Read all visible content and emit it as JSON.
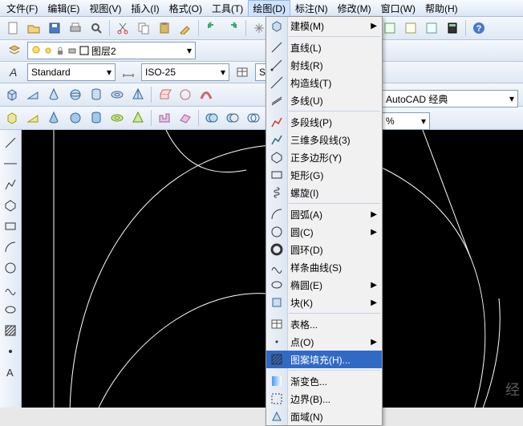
{
  "menubar": {
    "items": [
      {
        "label": "文件(F)"
      },
      {
        "label": "编辑(E)"
      },
      {
        "label": "视图(V)"
      },
      {
        "label": "插入(I)"
      },
      {
        "label": "格式(O)"
      },
      {
        "label": "工具(T)"
      },
      {
        "label": "绘图(D)",
        "open": true
      },
      {
        "label": "标注(N)"
      },
      {
        "label": "修改(M)"
      },
      {
        "label": "窗口(W)"
      },
      {
        "label": "帮助(H)"
      }
    ]
  },
  "layer": {
    "name": "图层2"
  },
  "styles": {
    "text": "Standard",
    "dim": "ISO-25",
    "table": "Standard"
  },
  "workspace": {
    "name": "AutoCAD 经典"
  },
  "zoom": {
    "pct": "%"
  },
  "draw_menu": {
    "items": [
      {
        "icon": "modeling",
        "label": "建模(M)",
        "sub": true
      },
      {
        "sep": true
      },
      {
        "icon": "line",
        "label": "直线(L)"
      },
      {
        "icon": "ray",
        "label": "射线(R)"
      },
      {
        "icon": "xline",
        "label": "构造线(T)"
      },
      {
        "icon": "mline",
        "label": "多线(U)"
      },
      {
        "sep": true
      },
      {
        "icon": "pline",
        "label": "多段线(P)"
      },
      {
        "icon": "3dpoly",
        "label": "三维多段线(3)"
      },
      {
        "icon": "polygon",
        "label": "正多边形(Y)"
      },
      {
        "icon": "rect",
        "label": "矩形(G)"
      },
      {
        "icon": "helix",
        "label": "螺旋(I)"
      },
      {
        "sep": true
      },
      {
        "icon": "arc",
        "label": "圆弧(A)",
        "sub": true
      },
      {
        "icon": "circle",
        "label": "圆(C)",
        "sub": true
      },
      {
        "icon": "donut",
        "label": "圆环(D)"
      },
      {
        "icon": "spline",
        "label": "样条曲线(S)"
      },
      {
        "icon": "ellipse",
        "label": "椭圆(E)",
        "sub": true
      },
      {
        "icon": "block",
        "label": "块(K)",
        "sub": true
      },
      {
        "sep": true
      },
      {
        "icon": "table",
        "label": "表格..."
      },
      {
        "icon": "point",
        "label": "点(O)",
        "sub": true
      },
      {
        "icon": "hatch",
        "label": "图案填充(H)...",
        "hl": true
      },
      {
        "sep": true
      },
      {
        "icon": "gradient",
        "label": "渐变色..."
      },
      {
        "icon": "boundary",
        "label": "边界(B)..."
      },
      {
        "icon": "region",
        "label": "面域(N)"
      }
    ]
  }
}
